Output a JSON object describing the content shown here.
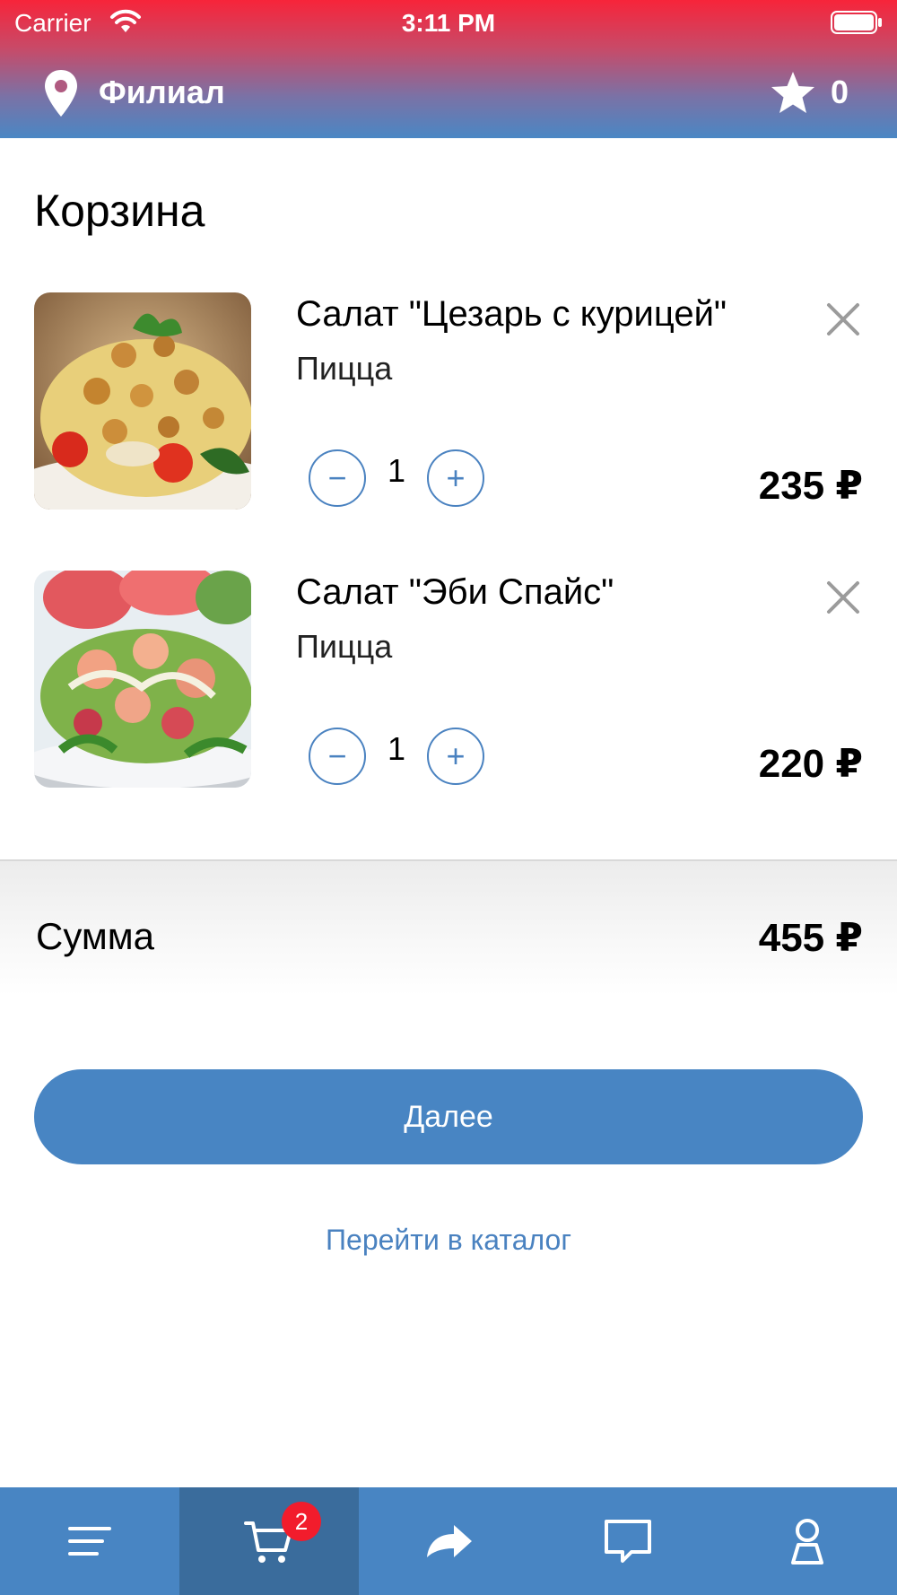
{
  "status_bar": {
    "carrier": "Carrier",
    "time": "3:11 PM"
  },
  "nav": {
    "branch_label": "Филиал",
    "favorites_count": "0"
  },
  "page": {
    "title": "Корзина"
  },
  "cart": {
    "items": [
      {
        "name": "Салат \"Цезарь с курицей\"",
        "category": "Пицца",
        "quantity": "1",
        "price": "235 ₽",
        "image": "caesar-salad"
      },
      {
        "name": "Салат \"Эби Спайс\"",
        "category": "Пицца",
        "quantity": "1",
        "price": "220 ₽",
        "image": "shrimp-salad"
      }
    ],
    "stepper": {
      "minus": "−",
      "plus": "+"
    }
  },
  "summary": {
    "label": "Сумма",
    "value": "455 ₽"
  },
  "actions": {
    "next_label": "Далее",
    "catalog_link": "Перейти в каталог"
  },
  "tab_bar": {
    "cart_badge": "2",
    "tabs": [
      "menu-icon",
      "cart-icon",
      "share-icon",
      "chat-icon",
      "profile-icon"
    ]
  },
  "colors": {
    "accent": "#4885c3",
    "header_top": "#f7243a",
    "badge": "#f21c2c"
  }
}
